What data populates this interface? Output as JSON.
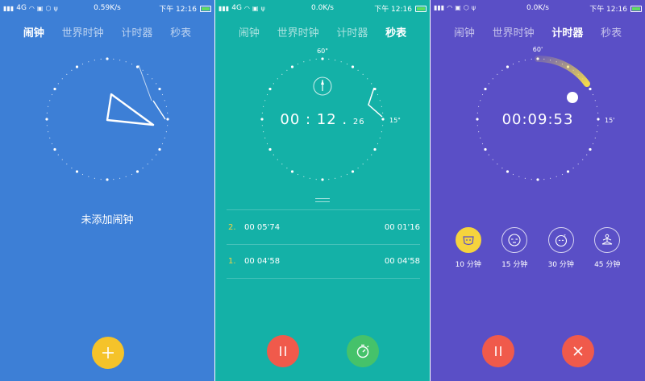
{
  "colors": {
    "alarm_bg": "#3d7fd6",
    "stopwatch_bg": "#14b1a7",
    "timer_bg": "#5a4fc6",
    "fab_yellow": "#f5c32a",
    "fab_red": "#f05a4b",
    "fab_green": "#45c26a",
    "lap_index": "#f3d443"
  },
  "alarm_screen": {
    "status": {
      "signal": "4G",
      "speed": "0.59K/s",
      "time": "下午 12:16"
    },
    "tabs": [
      {
        "label": "闹钟",
        "active": true
      },
      {
        "label": "世界时钟",
        "active": false
      },
      {
        "label": "计时器",
        "active": false
      },
      {
        "label": "秒表",
        "active": false
      }
    ],
    "empty_message": "未添加闹钟",
    "add_button": {
      "icon": "plus-icon"
    }
  },
  "stopwatch_screen": {
    "status": {
      "signal": "4G",
      "speed": "0.0K/s",
      "time": "下午 12:16"
    },
    "tabs": [
      {
        "label": "闹钟",
        "active": false
      },
      {
        "label": "世界时钟",
        "active": false
      },
      {
        "label": "计时器",
        "active": false
      },
      {
        "label": "秒表",
        "active": true
      }
    ],
    "dial_label_top": "60\"",
    "dial_label_right": "15\"",
    "time_main": "00 : 12 .",
    "time_fraction": "26",
    "laps": [
      {
        "index": "2.",
        "split": "00 05'74",
        "total": "00 01'16"
      },
      {
        "index": "1.",
        "split": "00 04'58",
        "total": "00 04'58"
      }
    ],
    "pause_button": {
      "icon": "pause-icon"
    },
    "lap_button": {
      "icon": "stopwatch-icon"
    }
  },
  "timer_screen": {
    "status": {
      "signal": "",
      "speed": "0.0K/s",
      "time": "下午 12:16"
    },
    "tabs": [
      {
        "label": "闹钟",
        "active": false
      },
      {
        "label": "世界时钟",
        "active": false
      },
      {
        "label": "计时器",
        "active": true
      },
      {
        "label": "秒表",
        "active": false
      }
    ],
    "dial_label_top": "60'",
    "dial_label_right": "15'",
    "time_main": "00:09:53",
    "presets": [
      {
        "label": "10 分钟",
        "icon": "face-mask-icon",
        "selected": true
      },
      {
        "label": "15 分钟",
        "icon": "sleepy-face-icon",
        "selected": false
      },
      {
        "label": "30 分钟",
        "icon": "nap-face-icon",
        "selected": false
      },
      {
        "label": "45 分钟",
        "icon": "meditation-icon",
        "selected": false
      }
    ],
    "pause_button": {
      "icon": "pause-icon"
    },
    "cancel_button": {
      "icon": "close-icon"
    }
  }
}
